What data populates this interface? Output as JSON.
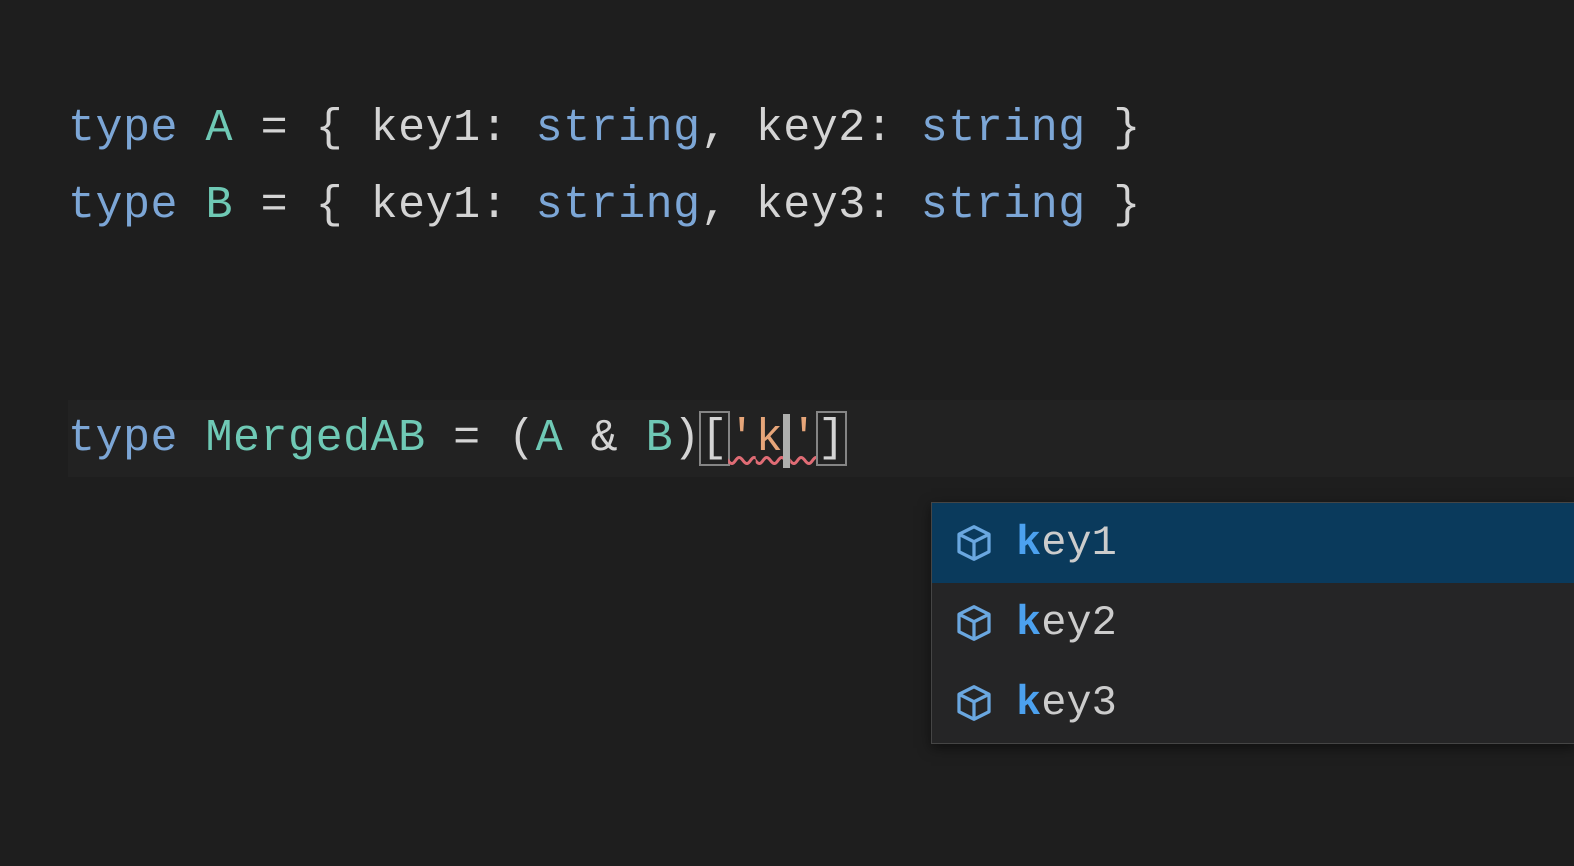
{
  "code": {
    "line1": {
      "kw": "type",
      "name": "A",
      "eq": " = { ",
      "k1": "key1",
      "c1": ": ",
      "t1": "string",
      "cm1": ", ",
      "k2": "key2",
      "c2": ": ",
      "t2": "string",
      "close": " }"
    },
    "line2": {
      "kw": "type",
      "name": "B",
      "eq": " = { ",
      "k1": "key1",
      "c1": ": ",
      "t1": "string",
      "cm1": ", ",
      "k2": "key3",
      "c2": ": ",
      "t2": "string",
      "close": " }"
    },
    "line3": {
      "kw": "type",
      "name": "MergedAB",
      "eq": " = (",
      "a": "A",
      "amp": " & ",
      "b": "B",
      "close_paren": ")",
      "lbrack": "[",
      "q1": "'",
      "typed": "k",
      "q2": "'",
      "rbrack": "]"
    }
  },
  "suggestions": {
    "items": [
      {
        "match": "k",
        "rest": "ey1",
        "selected": true
      },
      {
        "match": "k",
        "rest": "ey2",
        "selected": false
      },
      {
        "match": "k",
        "rest": "ey3",
        "selected": false
      }
    ]
  }
}
